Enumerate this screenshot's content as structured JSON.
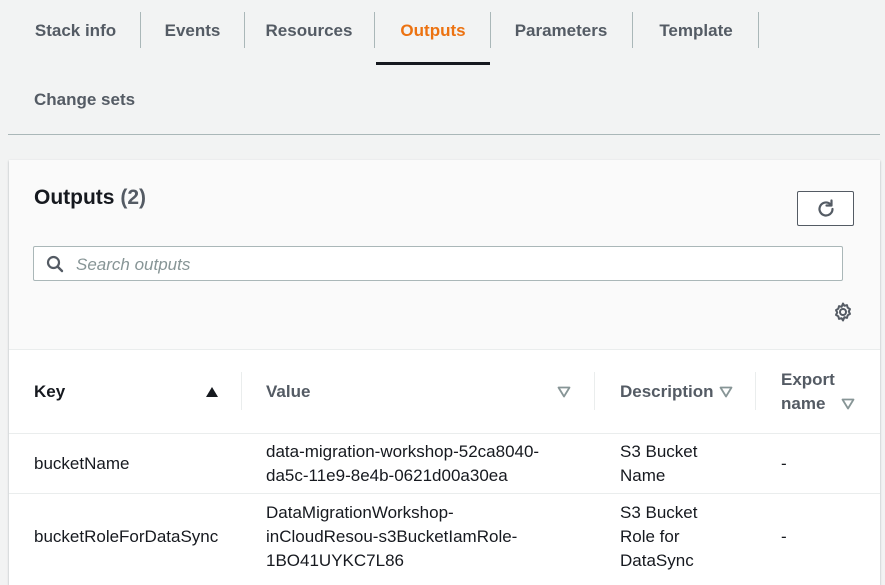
{
  "tabs": [
    {
      "label": "Stack info"
    },
    {
      "label": "Events"
    },
    {
      "label": "Resources"
    },
    {
      "label": "Outputs",
      "active": true
    },
    {
      "label": "Parameters"
    },
    {
      "label": "Template"
    },
    {
      "label": "Change sets"
    }
  ],
  "panel": {
    "title": "Outputs",
    "count": "(2)",
    "search_placeholder": "Search outputs"
  },
  "table": {
    "columns": [
      "Key",
      "Value",
      "Description",
      "Export name"
    ],
    "rows": [
      {
        "key": "bucketName",
        "value_lines": [
          "data-migration-workshop-52ca8040-",
          "da5c-11e9-8e4b-0621d00a30ea"
        ],
        "description_lines": [
          "S3 Bucket",
          "Name"
        ],
        "export": "-"
      },
      {
        "key": "bucketRoleForDataSync",
        "value_lines": [
          "DataMigrationWorkshop-",
          "inCloudResou-s3BucketIamRole-",
          "1BO41UYKC7L86"
        ],
        "description_lines": [
          "S3 Bucket",
          "Role for",
          "DataSync"
        ],
        "export": "-"
      }
    ]
  },
  "colors": {
    "accent": "#ec7211",
    "text": "#16191f",
    "muted": "#545b64",
    "background": "#f2f3f3"
  },
  "icons": [
    "refresh-icon",
    "search-icon",
    "gear-icon",
    "sort-ascending-icon",
    "sort-descending-icon"
  ]
}
